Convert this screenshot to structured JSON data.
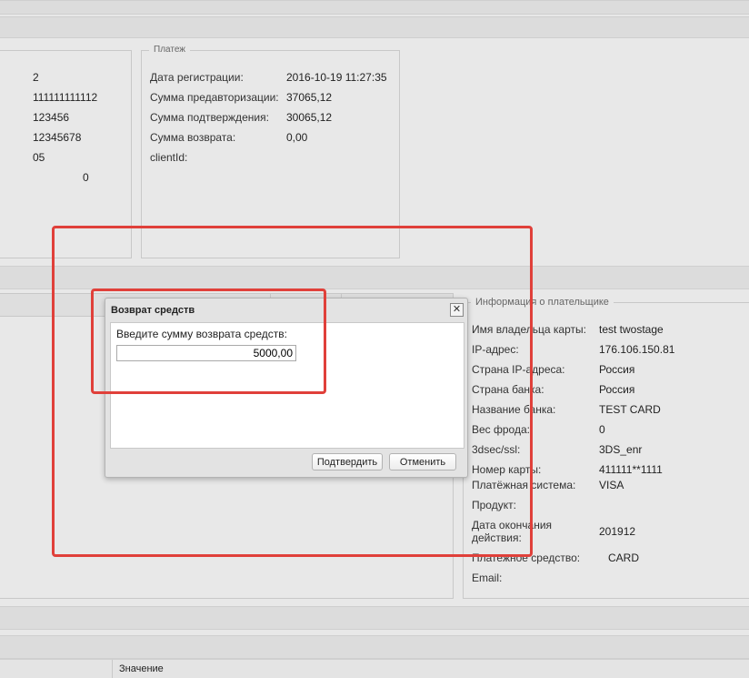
{
  "payment_section": {
    "legend": "Платеж",
    "rows": [
      {
        "label": "Дата регистрации:",
        "value": "2016-10-19 11:27:35"
      },
      {
        "label": "Сумма предавторизации:",
        "value": "37065,12"
      },
      {
        "label": "Сумма подтверждения:",
        "value": "30065,12"
      },
      {
        "label": "Сумма возврата:",
        "value": "0,00"
      },
      {
        "label": "clientId:",
        "value": ""
      }
    ]
  },
  "left_values": [
    "2",
    "111111111112",
    "123456",
    "12345678",
    "05",
    "0"
  ],
  "payer_section": {
    "legend": "Информация о плательщике",
    "rows": [
      {
        "label": "Имя владельца карты:",
        "value": "test twostage"
      },
      {
        "label": "IP-адрес:",
        "value": "176.106.150.81"
      },
      {
        "label": "Страна IP-адреса:",
        "value": "Россия"
      },
      {
        "label": "Страна банка:",
        "value": "Россия"
      },
      {
        "label": "Название банка:",
        "value": "TEST CARD"
      },
      {
        "label": "Вес фрода:",
        "value": "0"
      },
      {
        "label": "3dsec/ssl:",
        "value": "3DS_enr"
      },
      {
        "label": "Номер карты:",
        "value": "411111**1111"
      },
      {
        "label": "Платёжная система:",
        "value": "VISA"
      },
      {
        "label": "Продукт:",
        "value": ""
      },
      {
        "label": "Дата окончания действия:",
        "value": "201912"
      },
      {
        "label": "Платежное средство:",
        "value": "CARD"
      },
      {
        "label": "Email:",
        "value": ""
      }
    ]
  },
  "dialog": {
    "title": "Возврат средств",
    "close_glyph": "✕",
    "prompt": "Введите сумму возврата средств:",
    "amount": "5000,00",
    "confirm_label": "Подтвердить",
    "cancel_label": "Отменить"
  },
  "bottom_table": {
    "header_value": "Значение"
  },
  "colors": {
    "annotation_red": "#e0403a",
    "background": "#e8e8e8"
  }
}
